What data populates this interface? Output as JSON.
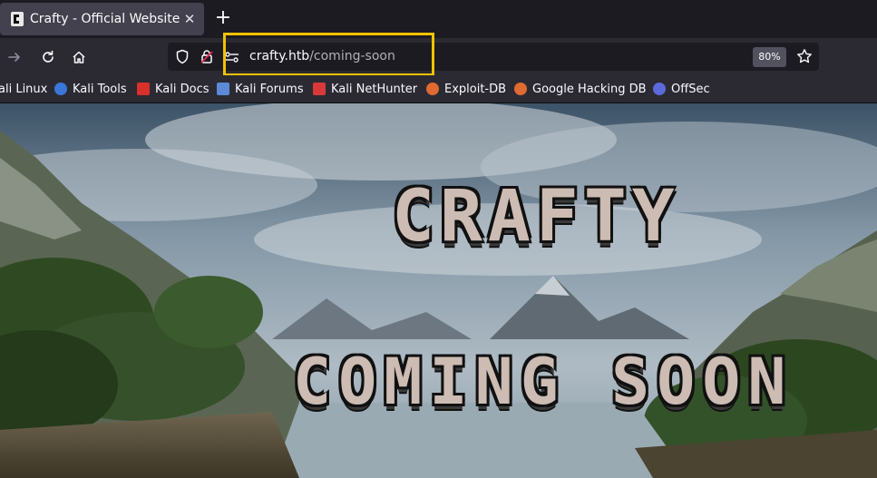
{
  "tab": {
    "title": "Crafty - Official Website",
    "close": "✕",
    "new_tab": "+"
  },
  "url": {
    "host": "crafty.htb",
    "path": "/coming-soon",
    "zoom": "80%"
  },
  "bookmarks": [
    {
      "label": "ali Linux",
      "icon": "kali-linux-icon",
      "color": "#3a77d8"
    },
    {
      "label": "Kali Tools",
      "icon": "kali-tools-icon",
      "color": "#3a77d8"
    },
    {
      "label": "Kali Docs",
      "icon": "kali-docs-icon",
      "color": "#d8302a"
    },
    {
      "label": "Kali Forums",
      "icon": "kali-forums-icon",
      "color": "#5a8ad8"
    },
    {
      "label": "Kali NetHunter",
      "icon": "kali-nethunter-icon",
      "color": "#d83a3a"
    },
    {
      "label": "Exploit-DB",
      "icon": "exploit-db-icon",
      "color": "#e06a30"
    },
    {
      "label": "Google Hacking DB",
      "icon": "ghdb-icon",
      "color": "#e06a30"
    },
    {
      "label": "OffSec",
      "icon": "offsec-icon",
      "color": "#5b6ad8"
    }
  ],
  "page": {
    "title": "CRAFTY",
    "subtitle": "COMING SOON"
  },
  "colors": {
    "highlight": "#f2c200",
    "urlbar": "#1c1b22",
    "toolbar": "#2b2a33"
  }
}
